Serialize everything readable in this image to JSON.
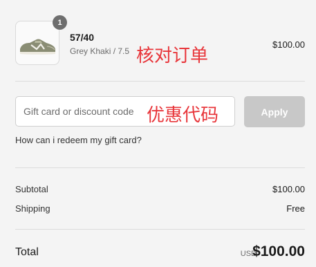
{
  "product": {
    "quantity_badge": "1",
    "name": "57/40",
    "variant": "Grey Khaki / 7.5",
    "price": "$100.00",
    "annotation": "核对订单",
    "image_icon": "sneaker-image"
  },
  "discount": {
    "placeholder": "Gift card or discount code",
    "annotation": "优惠代码",
    "apply_label": "Apply",
    "help_link": "How can i redeem my gift card?"
  },
  "summary": {
    "subtotal_label": "Subtotal",
    "subtotal_value": "$100.00",
    "shipping_label": "Shipping",
    "shipping_value": "Free",
    "total_label": "Total",
    "total_currency": "USD",
    "total_value": "$100.00"
  },
  "colors": {
    "annotation_red": "#e8353a",
    "apply_disabled": "#c8c8c8",
    "badge": "#6e6e6e"
  }
}
